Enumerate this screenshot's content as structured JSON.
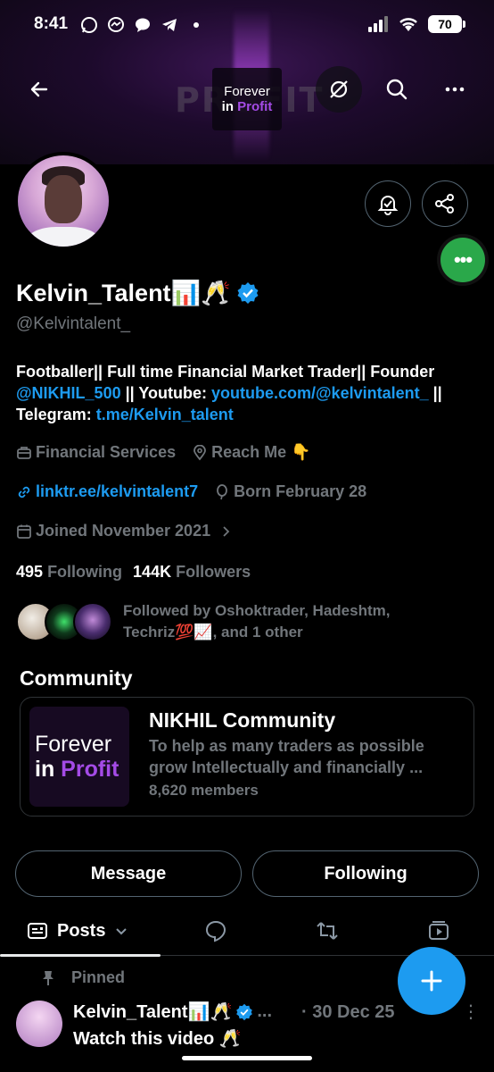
{
  "status": {
    "time": "8:41",
    "battery": "70"
  },
  "banner": {
    "bg_word": "PROFIT",
    "logo_line1": "Forever",
    "logo_in": "in",
    "logo_profit": "Profit"
  },
  "profile": {
    "name": "Kelvin_Talent📊🥂",
    "handle": "@Kelvintalent_",
    "bio_text1": "Footballer|| Full time Financial Market Trader|| Founder ",
    "bio_link1": "@NIKHIL_500",
    "bio_text2": " || Youtube: ",
    "bio_link2": "youtube.com/@kelvintalent_",
    "bio_text3": " || Telegram: ",
    "bio_link3": "t.me/Kelvin_talent",
    "category": "Financial Services",
    "location": "Reach Me 👇",
    "website": "linktr.ee/kelvintalent7",
    "birthday": "Born February 28",
    "joined": "Joined November 2021",
    "following_count": "495",
    "following_label": "Following",
    "followers_count": "144K",
    "followers_label": "Followers",
    "followed_by": "Followed by Oshoktrader, Hadeshtm, Techriz💯📈, and 1 other"
  },
  "community": {
    "section_title": "Community",
    "logo_line1": "Forever",
    "logo_in": "in",
    "logo_profit": "Profit",
    "name": "NIKHIL Community",
    "description": "To help as many traders as possible grow Intellectually and financially ...",
    "members": "8,620 members"
  },
  "actions": {
    "message": "Message",
    "following": "Following"
  },
  "tabs": {
    "posts": "Posts"
  },
  "post": {
    "pinned_label": "Pinned",
    "author": "Kelvin_Talent📊🥂",
    "ellipsis": "...",
    "date": "· 30 Dec 25",
    "text": "Watch this video 🥂"
  },
  "colors": {
    "accent": "#1d9bf0",
    "verified": "#1d9bf0",
    "fab_green": "#2aa84a",
    "brand_purple": "#a44be6"
  },
  "icons": [
    "back-arrow-icon",
    "no-grok-icon",
    "search-icon",
    "more-icon",
    "notification-bell-icon",
    "share-icon",
    "verified-badge-icon",
    "briefcase-icon",
    "location-pin-icon",
    "link-icon",
    "balloon-icon",
    "calendar-icon",
    "chevron-right-icon",
    "chevron-down-icon",
    "posts-icon",
    "replies-icon",
    "repost-icon",
    "media-icon",
    "pin-icon",
    "plus-icon"
  ]
}
